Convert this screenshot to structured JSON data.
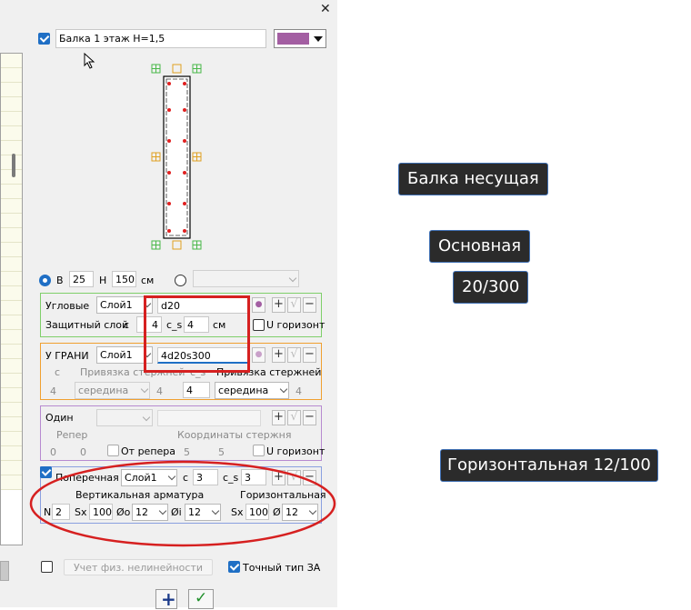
{
  "window": {
    "close_glyph": "✕"
  },
  "header": {
    "title": "Балка 1 этаж H=1,5",
    "color_swatch": "#a35ea2",
    "enabled": true
  },
  "section_size": {
    "b_label": "B",
    "b_value": "25",
    "h_label": "H",
    "h_value": "150",
    "unit": "см"
  },
  "corner": {
    "label": "Угловые",
    "layer": "Слой1",
    "rebar": "d20",
    "cover_label": "Защитный слой",
    "c_label": "с",
    "c_value": "4",
    "cs_label": "с_s",
    "cs_value": "4",
    "unit": "см",
    "u_label": "U горизонт"
  },
  "edge": {
    "label": "У ГРАНИ",
    "layer": "Слой1",
    "rebar": "4d20s300",
    "c_label": "с",
    "anchor_label_1": "Привязка стержней",
    "c_s_label": "с_s",
    "anchor_label_2": "Привязка стержней",
    "c_value": "4",
    "anchor_1": "середина",
    "mid_value": "4",
    "cs_value": "4",
    "anchor_2": "середина"
  },
  "single": {
    "label": "Один",
    "ref_label": "Репер",
    "coords_label": "Координаты стержня",
    "ref_x": "0",
    "ref_y": "0",
    "from_ref_label": "От репера",
    "coord_x": "5",
    "coord_y": "5",
    "u_label": "U горизонт"
  },
  "transverse": {
    "label": "Поперечная",
    "layer": "Слой1",
    "c_label": "с",
    "c_value": "3",
    "cs_label": "с_s",
    "cs_value": "3",
    "vertical_label": "Вертикальная арматура",
    "horizontal_label": "Горизонтальная",
    "n_label": "N",
    "n_value": "2",
    "sx_label": "Sx",
    "sx_value": "100",
    "dia_o_label": "Øo",
    "dia_o_value": "12",
    "dia_i_label": "Øi",
    "dia_i_value": "12",
    "sx2_label": "Sx",
    "sx2_value": "100",
    "dia_label": "Ø",
    "dia_value": "12"
  },
  "footer": {
    "nonlinear_label": "Учет физ. нелинейности",
    "exact_type_label": "Точный тип ЗА"
  },
  "toolbar": {
    "add_glyph": "+",
    "ok_glyph": "✓",
    "plus_small": "+",
    "check_small": "√",
    "minus_small": "−"
  },
  "annotations": {
    "tip_1": "Балка несущая",
    "tip_2": "Основная",
    "tip_3": "20/300",
    "tip_4": "Горизонтальная 12/100"
  },
  "colors": {
    "corner_group": "#7fcf6a",
    "edge_group": "#f0a030",
    "single_group": "#b78ad0",
    "trans_group": "#8aa0e0",
    "rebar_dot": "#e02020",
    "highlight": "#d62020"
  }
}
